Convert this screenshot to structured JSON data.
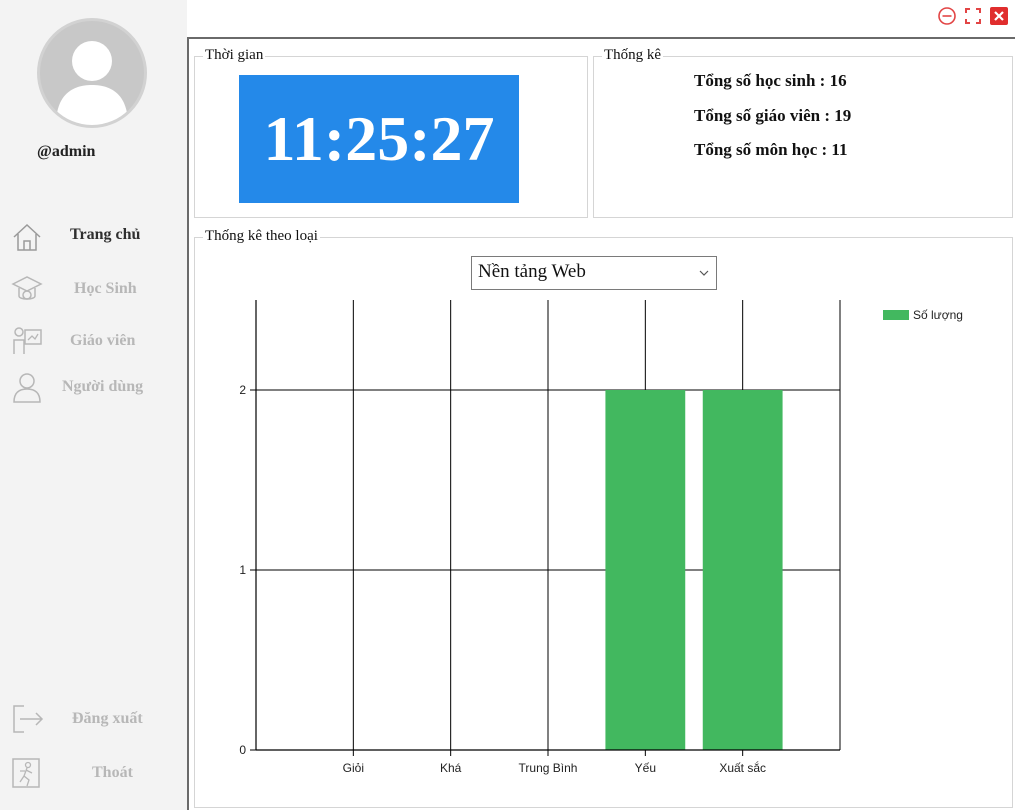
{
  "user": {
    "username": "@admin",
    "avatar_icon": "user-avatar-icon"
  },
  "sidebar": {
    "items": [
      {
        "label": "Trang chủ",
        "icon": "home-icon",
        "active": true
      },
      {
        "label": "Học Sinh",
        "icon": "student-icon",
        "active": false
      },
      {
        "label": "Giáo viên",
        "icon": "teacher-icon",
        "active": false
      },
      {
        "label": "Người dùng",
        "icon": "user-icon",
        "active": false
      }
    ],
    "bottom_items": [
      {
        "label": "Đăng xuất",
        "icon": "logout-icon"
      },
      {
        "label": "Thoát",
        "icon": "exit-icon"
      }
    ]
  },
  "window_controls": {
    "minimize_icon": "minimize-icon",
    "maximize_icon": "maximize-icon",
    "close_icon": "close-icon"
  },
  "time_group": {
    "title": "Thời gian",
    "clock": "11:25:27",
    "clock_color": "#2489e9"
  },
  "stats_group": {
    "title": "Thống kê",
    "lines": [
      "Tổng số học sinh : 16",
      "Tổng số giáo viên : 19",
      "Tổng số môn học : 11"
    ]
  },
  "category_group": {
    "title": "Thống kê theo loại",
    "dropdown": {
      "selected": "Nền tảng Web"
    }
  },
  "chart_data": {
    "type": "bar",
    "categories": [
      "Giỏi",
      "Khá",
      "Trung Bình",
      "Yếu",
      "Xuất sắc"
    ],
    "series": [
      {
        "name": "Số lượng",
        "values": [
          0,
          0,
          0,
          2,
          2
        ],
        "color": "#42b85f"
      }
    ],
    "yticks": [
      0,
      1,
      2
    ],
    "ylim": [
      0,
      2.5
    ],
    "grid": true,
    "legend_position": "top-right"
  }
}
